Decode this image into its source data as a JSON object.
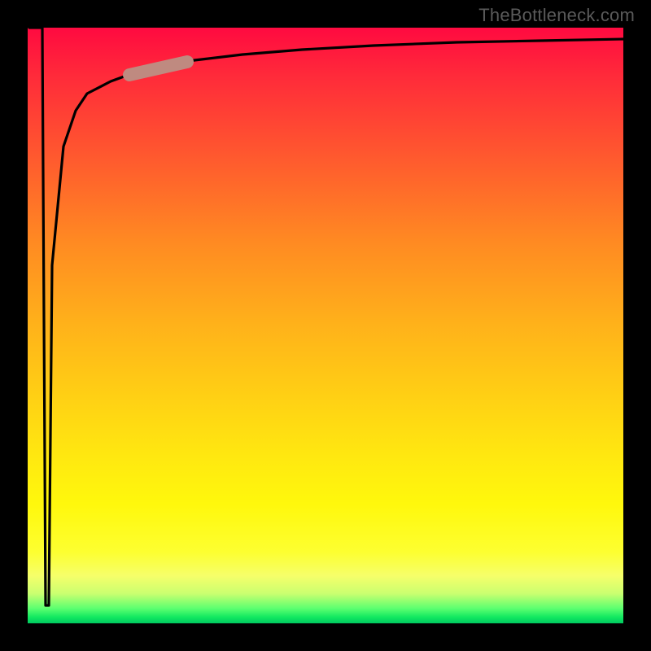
{
  "watermark": "TheBottleneck.com",
  "colors": {
    "frame": "#000000",
    "curve": "#000000",
    "marker": "#bf8a80",
    "gradient_top": "#ff0a40",
    "gradient_bottom": "#00c860"
  },
  "chart_data": {
    "type": "line",
    "title": "",
    "xlabel": "",
    "ylabel": "",
    "xlim": [
      0,
      100
    ],
    "ylim": [
      0,
      100
    ],
    "note": "Axes are unlabeled; values estimated from curve geometry on a 0–100 normalized scale. Curve resembles y = 100 - 100/(x) style saturation: a sharp vertical spike near x≈3 dropping to y≈3, then recovering and asymptoting toward y≈98.",
    "series": [
      {
        "name": "bottleneck-curve",
        "x": [
          0,
          2,
          3,
          4,
          6,
          8,
          10,
          14,
          18,
          22,
          28,
          36,
          46,
          58,
          72,
          86,
          100
        ],
        "y": [
          100,
          100,
          3,
          60,
          80,
          86,
          89,
          91,
          92.5,
          93.5,
          94.5,
          95.5,
          96.3,
          97,
          97.5,
          97.8,
          98
        ]
      }
    ],
    "marker": {
      "description": "short thick highlighted segment on the curve",
      "approx_x_range": [
        18,
        26
      ],
      "approx_y_range": [
        90,
        93
      ],
      "color": "#bf8a80"
    },
    "background_gradient": {
      "orientation": "vertical",
      "stops": [
        {
          "pos": 0.0,
          "color": "#ff0a40"
        },
        {
          "pos": 0.5,
          "color": "#ffb21a"
        },
        {
          "pos": 0.8,
          "color": "#fff80c"
        },
        {
          "pos": 0.97,
          "color": "#5cff70"
        },
        {
          "pos": 1.0,
          "color": "#00c860"
        }
      ]
    }
  }
}
